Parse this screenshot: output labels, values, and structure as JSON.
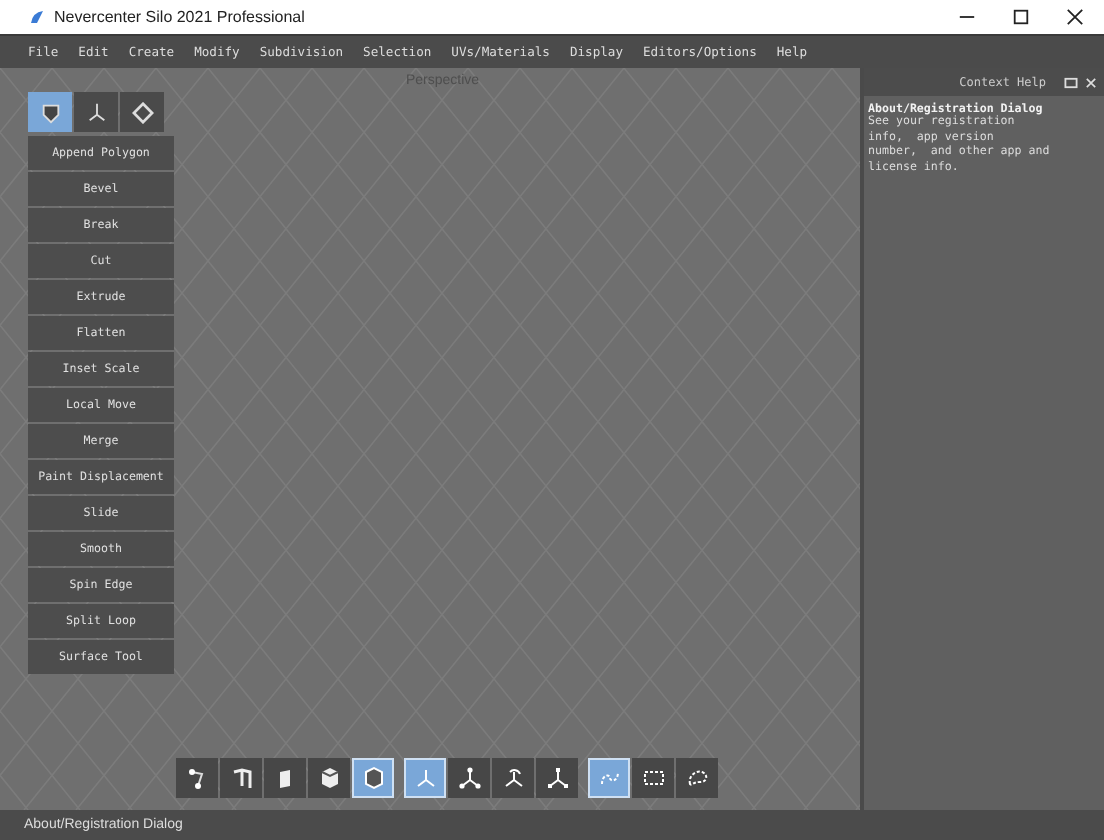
{
  "window": {
    "title": "Nevercenter Silo 2021 Professional"
  },
  "menu": [
    "File",
    "Edit",
    "Create",
    "Modify",
    "Subdivision",
    "Selection",
    "UVs/Materials",
    "Display",
    "Editors/Options",
    "Help"
  ],
  "viewport": {
    "label": "Perspective"
  },
  "tool_tabs": [
    {
      "kind": "polygon",
      "selected": true
    },
    {
      "kind": "manipulator",
      "selected": false
    },
    {
      "kind": "diamond",
      "selected": false
    }
  ],
  "tools": [
    "Append Polygon",
    "Bevel",
    "Break",
    "Cut",
    "Extrude",
    "Flatten",
    "Inset Scale",
    "Local Move",
    "Merge",
    "Paint Displacement",
    "Slide",
    "Smooth",
    "Spin Edge",
    "Split Loop",
    "Surface Tool"
  ],
  "bottom_toolbar": [
    [
      {
        "kind": "vertex",
        "selected": false
      },
      {
        "kind": "edge",
        "selected": false
      },
      {
        "kind": "face",
        "selected": false
      },
      {
        "kind": "object-part",
        "selected": false
      },
      {
        "kind": "object",
        "selected": true
      }
    ],
    [
      {
        "kind": "axes",
        "selected": true
      },
      {
        "kind": "move",
        "selected": false
      },
      {
        "kind": "rotate",
        "selected": false
      },
      {
        "kind": "scale",
        "selected": false
      }
    ],
    [
      {
        "kind": "paint",
        "selected": true
      },
      {
        "kind": "rect",
        "selected": false
      },
      {
        "kind": "lasso",
        "selected": false
      }
    ]
  ],
  "context_help": {
    "title": "Context Help",
    "heading": "About/Registration Dialog",
    "body": "See your registration\ninfo,  app version\nnumber,  and other app and\nlicense info."
  },
  "status_bar": "About/Registration Dialog"
}
